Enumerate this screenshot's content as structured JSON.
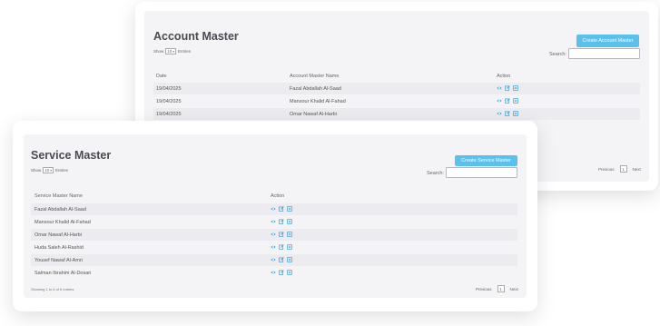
{
  "account": {
    "title": "Account Master",
    "show_prefix": "Show",
    "entries_value": "10",
    "show_suffix": "Entries",
    "create_label": "Create Account Master",
    "search_label": "Search:",
    "headers": {
      "date": "Date",
      "name": "Account Master Name",
      "action": "Action"
    },
    "rows": [
      {
        "date": "19/04/2025",
        "name": "Fazal Abdallah Al-Saad"
      },
      {
        "date": "19/04/2025",
        "name": "Mansour Khalid Al-Fahad"
      },
      {
        "date": "19/04/2025",
        "name": "Omar Nawaf Al-Harbi"
      }
    ],
    "pager": {
      "previous": "Previous",
      "page": "1",
      "next": "Next"
    }
  },
  "service": {
    "title": "Service Master",
    "show_prefix": "Show",
    "entries_value": "10",
    "show_suffix": "Entries",
    "create_label": "Create Service Master",
    "search_label": "Search:",
    "headers": {
      "name": "Service Master Name",
      "action": "Action"
    },
    "rows": [
      {
        "name": "Fazal Abdallah Al-Saad"
      },
      {
        "name": "Mansour Khalid Al-Fahad"
      },
      {
        "name": "Omar Nawaf Al-Harbi"
      },
      {
        "name": "Huda Saleh Al-Rashid"
      },
      {
        "name": "Yousef Nawaf Al-Amri"
      },
      {
        "name": "Salman Ibrahim Al-Dosari"
      }
    ],
    "info": "Showing 1 to 6 of 6 entries",
    "pager": {
      "previous": "Previous",
      "page": "1",
      "next": "Next"
    }
  },
  "colors": {
    "accent": "#5bc0eb",
    "icon": "#3aa6d9"
  },
  "icons": [
    "eye-icon",
    "edit-icon",
    "delete-icon"
  ]
}
